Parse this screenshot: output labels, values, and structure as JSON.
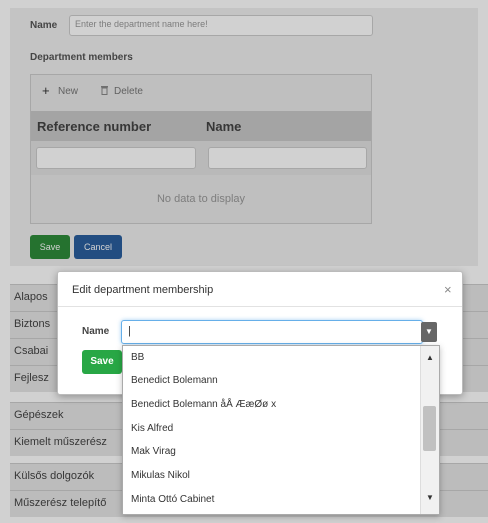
{
  "form": {
    "name_label": "Name",
    "name_placeholder": "Enter the department name here!",
    "members_label": "Department members",
    "toolbar": {
      "new_label": "New",
      "delete_label": "Delete"
    },
    "grid": {
      "columns": [
        "Reference number",
        "Name"
      ],
      "empty_text": "No data to display"
    },
    "save_label": "Save",
    "cancel_label": "Cancel"
  },
  "background_list": [
    "Alapos",
    "Biztons",
    "Csabai",
    "Fejlesz",
    "Gépészek",
    "Kiemelt műszerész",
    "Külsős dolgozók",
    "Műszerész telepítő"
  ],
  "modal": {
    "title": "Edit department membership",
    "close_symbol": "×",
    "name_label": "Name",
    "name_value": "|",
    "save_label": "Save"
  },
  "dropdown": {
    "options": [
      "BB",
      "Benedict Bolemann",
      "Benedict Bolemann åÅ ÆæØø x",
      "Kis Alfred",
      "Mak Virag",
      "Mikulas Nikol",
      "Minta Ottó Cabinet"
    ]
  },
  "colors": {
    "green": "#28a745",
    "dark_green": "#2e8b3a",
    "blue": "#2a5f9e",
    "focus": "#66afe9"
  }
}
